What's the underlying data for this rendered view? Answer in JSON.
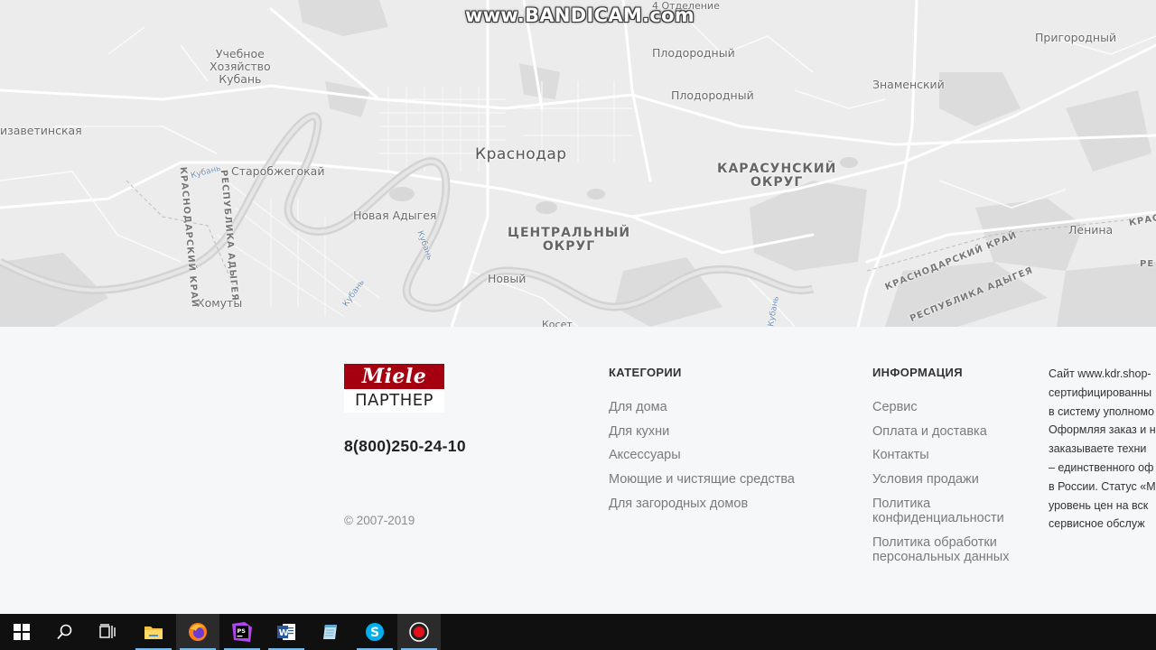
{
  "watermark": "www.BANDICAM.com",
  "map": {
    "places": {
      "uchebnoe": [
        "Учебное",
        "Хозяйство",
        "Кубань"
      ],
      "elizavetinskaya": "изаветинская",
      "starobzhegokai": "Старобжегокай",
      "novaya_adygeya": "Новая Адыгея",
      "khomuty": "Хомуты",
      "krasnodar": "Краснодар",
      "plodorodny_1": "Плодородный",
      "plodorodny_2": "Плодородный",
      "otdelenie": "4 Отделение",
      "znamensky": "Знаменский",
      "prigorodny": "Пригородный",
      "lenina": "Ленина",
      "novy": "Новый",
      "koset": "Косет",
      "karasunsky": [
        "КАРАСУНСКИЙ",
        "ОКРУГ"
      ],
      "centralny": [
        "ЦЕНТРАЛЬНЫЙ",
        "ОКРУГ"
      ],
      "river_kuban_1": "Кубань",
      "river_kuban_2": "Кубань",
      "river_kuban_3": "Кубань",
      "river_kuban_4": "Кубань",
      "region_krasnodar_left": "КРАСНОДАРСКИЙ КРАЙ",
      "region_adygea_left": "РЕСПУБЛИКА АДЫГЕЯ",
      "region_krasnodar_right": "КРАСНОДАРСКИЙ КРАЙ",
      "region_adygea_right": "РЕСПУБЛИКА АДЫГЕЯ",
      "edge_kras": "КРАС",
      "edge_re": "РЕ"
    }
  },
  "footer": {
    "logo_top": "Miele",
    "logo_bottom": "ПАРТНЕР",
    "phone": "8(800)250-24-10",
    "copyright": "© 2007-2019",
    "categories": {
      "heading": "КАТЕГОРИИ",
      "items": [
        "Для дома",
        "Для кухни",
        "Аксессуары",
        "Моющие и чистящие средства",
        "Для загородных домов"
      ]
    },
    "information": {
      "heading": "ИНФОРМАЦИЯ",
      "items": [
        "Сервис",
        "Оплата и доставка",
        "Контакты",
        "Условия продажи",
        "Политика конфиденциальности",
        "Политика обработки персональных данных"
      ]
    },
    "about_lines": [
      "Сайт www.kdr.shop-",
      "сертифицированны",
      "в систему уполномо",
      "Оформляя заказ и н",
      "заказываете техни",
      "– единственного оф",
      "в России. Статус «М",
      "уровень цен на вск",
      "сервисное обслуж"
    ]
  },
  "taskbar": {
    "apps": [
      "start",
      "search",
      "task-view",
      "file-explorer",
      "firefox",
      "phpstorm",
      "word",
      "notepad",
      "skype",
      "bandicam"
    ]
  }
}
